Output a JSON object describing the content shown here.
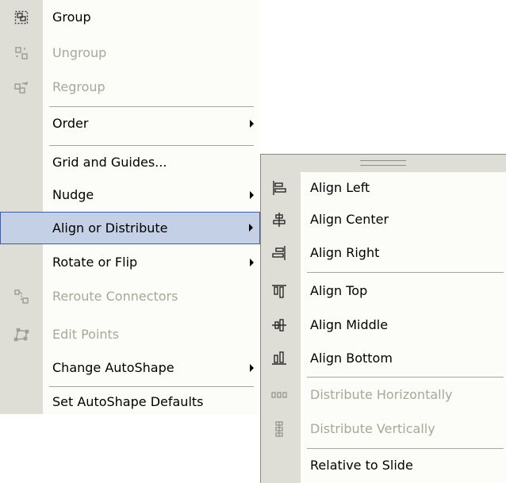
{
  "main_menu": {
    "items": [
      {
        "label": "Group",
        "icon": "group-icon",
        "enabled": true
      },
      {
        "label": "Ungroup",
        "icon": "ungroup-icon",
        "enabled": false
      },
      {
        "label": "Regroup",
        "icon": "regroup-icon",
        "enabled": false
      },
      {
        "label": "Order",
        "submenu": true,
        "enabled": true
      },
      {
        "label": "Grid and Guides...",
        "enabled": true
      },
      {
        "label": "Nudge",
        "submenu": true,
        "enabled": true
      },
      {
        "label": "Align or Distribute",
        "submenu": true,
        "enabled": true,
        "selected": true
      },
      {
        "label": "Rotate or Flip",
        "submenu": true,
        "enabled": true
      },
      {
        "label": "Reroute Connectors",
        "icon": "reroute-connectors-icon",
        "enabled": false
      },
      {
        "label": "Edit Points",
        "icon": "edit-points-icon",
        "enabled": false
      },
      {
        "label": "Change AutoShape",
        "submenu": true,
        "enabled": true
      },
      {
        "label": "Set AutoShape Defaults",
        "enabled": true
      }
    ]
  },
  "sub_menu": {
    "items": [
      {
        "label": "Align Left",
        "icon": "align-left-icon",
        "enabled": true
      },
      {
        "label": "Align Center",
        "icon": "align-center-icon",
        "enabled": true
      },
      {
        "label": "Align Right",
        "icon": "align-right-icon",
        "enabled": true
      },
      {
        "label": "Align Top",
        "icon": "align-top-icon",
        "enabled": true
      },
      {
        "label": "Align Middle",
        "icon": "align-middle-icon",
        "enabled": true
      },
      {
        "label": "Align Bottom",
        "icon": "align-bottom-icon",
        "enabled": true
      },
      {
        "label": "Distribute Horizontally",
        "icon": "distribute-horizontally-icon",
        "enabled": false
      },
      {
        "label": "Distribute Vertically",
        "icon": "distribute-vertically-icon",
        "enabled": false
      },
      {
        "label": "Relative to Slide",
        "enabled": true
      }
    ]
  },
  "colors": {
    "gutter": "#deded6",
    "menu_background": "#fcfcf9",
    "selection_fill": "#c3d0e6",
    "selection_border": "#3a5f9e",
    "disabled_text": "#a8a898"
  }
}
